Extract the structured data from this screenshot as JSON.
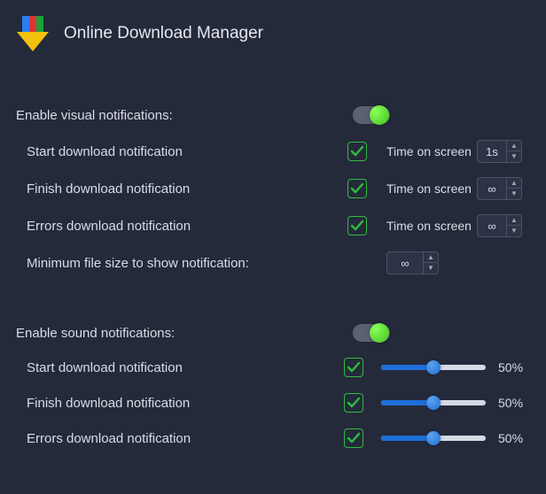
{
  "app": {
    "title": "Online Download Manager"
  },
  "visual": {
    "header": "Enable visual notifications:",
    "enabled": true,
    "rows": [
      {
        "label": "Start download notification",
        "checked": true,
        "timeLabel": "Time on screen",
        "value": "1s"
      },
      {
        "label": "Finish download notification",
        "checked": true,
        "timeLabel": "Time on screen",
        "value": "∞"
      },
      {
        "label": "Errors download notification",
        "checked": true,
        "timeLabel": "Time on screen",
        "value": "∞"
      }
    ],
    "minSizeLabel": "Minimum file size to show notification:",
    "minSizeValue": "∞"
  },
  "sound": {
    "header": "Enable sound notifications:",
    "enabled": true,
    "rows": [
      {
        "label": "Start download notification",
        "checked": true,
        "pct": "50%"
      },
      {
        "label": "Finish download notification",
        "checked": true,
        "pct": "50%"
      },
      {
        "label": "Errors download notification",
        "checked": true,
        "pct": "50%"
      }
    ]
  }
}
